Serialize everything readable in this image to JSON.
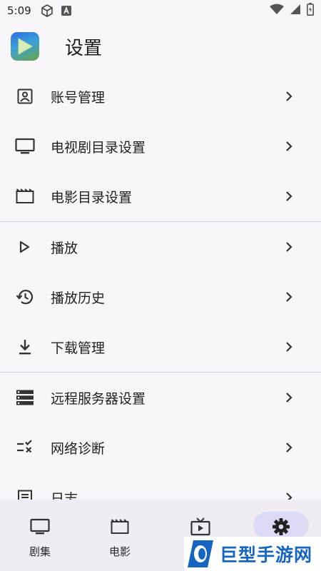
{
  "status_bar": {
    "time": "5:09",
    "icons": [
      "cube-icon",
      "a-box-icon"
    ],
    "right_icons": [
      "wifi-icon",
      "signal-icon",
      "battery-icon"
    ]
  },
  "header": {
    "app_icon": "play-app-icon",
    "title": "设置"
  },
  "settings": [
    {
      "label": "账号管理",
      "icon": "account-box-icon"
    },
    {
      "label": "电视剧目录设置",
      "icon": "tv-icon"
    },
    {
      "label": "电影目录设置",
      "icon": "movie-icon"
    },
    {
      "label": "播放",
      "icon": "play-icon"
    },
    {
      "label": "播放历史",
      "icon": "history-icon"
    },
    {
      "label": "下载管理",
      "icon": "download-icon"
    },
    {
      "label": "远程服务器设置",
      "icon": "server-icon"
    },
    {
      "label": "网络诊断",
      "icon": "rule-icon"
    },
    {
      "label": "日志",
      "icon": "log-icon"
    }
  ],
  "bottom_nav": [
    {
      "label": "剧集",
      "icon": "tv-icon",
      "selected": false
    },
    {
      "label": "电影",
      "icon": "movie-icon",
      "selected": false
    },
    {
      "label": "",
      "icon": "live-tv-icon",
      "selected": false
    },
    {
      "label": "",
      "icon": "gear-icon",
      "selected": true
    }
  ],
  "colors": {
    "background": "#f8f6fb",
    "nav_background": "#efedf3",
    "selected_pill": "#dcdaf5",
    "watermark_blue": "#1565c0"
  },
  "watermark": {
    "text": "巨型手游网"
  }
}
